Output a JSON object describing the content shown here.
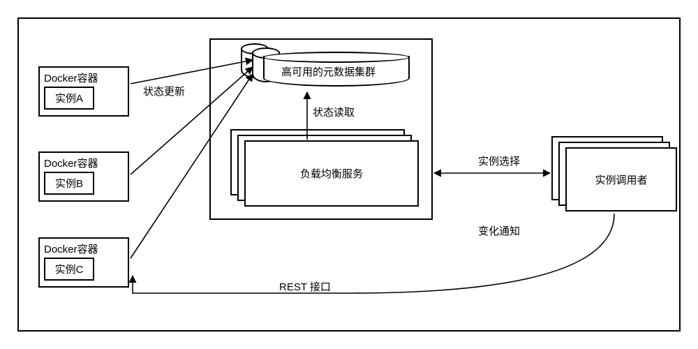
{
  "docker": {
    "title": "Docker容器",
    "instanceA": "实例A",
    "instanceB": "实例B",
    "instanceC": "实例C"
  },
  "cluster_label": "高可用的元数据集群",
  "load_balance_label": "负载均衡服务",
  "caller_label": "实例调用者",
  "edges": {
    "state_update": "状态更新",
    "state_read": "状态读取",
    "instance_select": "实例选择",
    "change_notify": "变化通知",
    "rest_api": "REST 接口"
  }
}
